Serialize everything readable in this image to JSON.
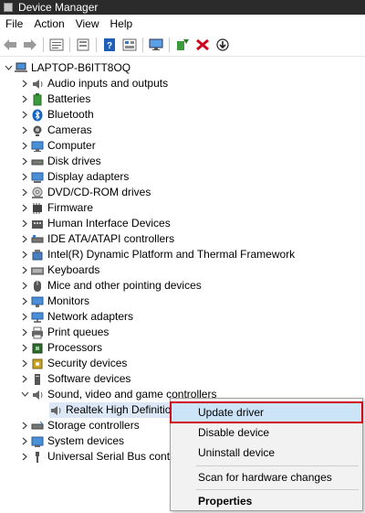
{
  "window": {
    "title": "Device Manager"
  },
  "menu": [
    "File",
    "Action",
    "View",
    "Help"
  ],
  "toolbar": [
    "back-icon",
    "forward-icon",
    "sep",
    "properties-icon",
    "sep",
    "show-hidden-icon",
    "sep",
    "help-icon",
    "view-icon",
    "sep",
    "monitor-icon",
    "sep",
    "add-driver-icon",
    "uninstall-icon",
    "update-icon"
  ],
  "tree": {
    "root": "LAPTOP-B6ITT8OQ",
    "items": [
      {
        "label": "Audio inputs and outputs",
        "icon": "speaker-icon"
      },
      {
        "label": "Batteries",
        "icon": "battery-icon"
      },
      {
        "label": "Bluetooth",
        "icon": "bluetooth-icon"
      },
      {
        "label": "Cameras",
        "icon": "camera-icon"
      },
      {
        "label": "Computer",
        "icon": "computer-icon"
      },
      {
        "label": "Disk drives",
        "icon": "disk-icon"
      },
      {
        "label": "Display adapters",
        "icon": "display-icon"
      },
      {
        "label": "DVD/CD-ROM drives",
        "icon": "dvd-icon"
      },
      {
        "label": "Firmware",
        "icon": "firmware-icon"
      },
      {
        "label": "Human Interface Devices",
        "icon": "hid-icon"
      },
      {
        "label": "IDE ATA/ATAPI controllers",
        "icon": "ide-icon"
      },
      {
        "label": "Intel(R) Dynamic Platform and Thermal Framework",
        "icon": "chip-icon"
      },
      {
        "label": "Keyboards",
        "icon": "keyboard-icon"
      },
      {
        "label": "Mice and other pointing devices",
        "icon": "mouse-icon"
      },
      {
        "label": "Monitors",
        "icon": "monitor-icon"
      },
      {
        "label": "Network adapters",
        "icon": "network-icon"
      },
      {
        "label": "Print queues",
        "icon": "printer-icon"
      },
      {
        "label": "Processors",
        "icon": "processor-icon"
      },
      {
        "label": "Security devices",
        "icon": "security-icon"
      },
      {
        "label": "Software devices",
        "icon": "software-icon"
      },
      {
        "label": "Sound, video and game controllers",
        "icon": "speaker-icon",
        "expanded": true
      },
      {
        "label": "Realtek High Definition",
        "icon": "speaker-icon",
        "child": true
      },
      {
        "label": "Storage controllers",
        "icon": "storage-icon"
      },
      {
        "label": "System devices",
        "icon": "system-icon"
      },
      {
        "label": "Universal Serial Bus contro",
        "icon": "usb-icon"
      }
    ]
  },
  "context_menu": {
    "items": [
      "Update driver",
      "Disable device",
      "Uninstall device",
      "Scan for hardware changes",
      "Properties"
    ]
  }
}
